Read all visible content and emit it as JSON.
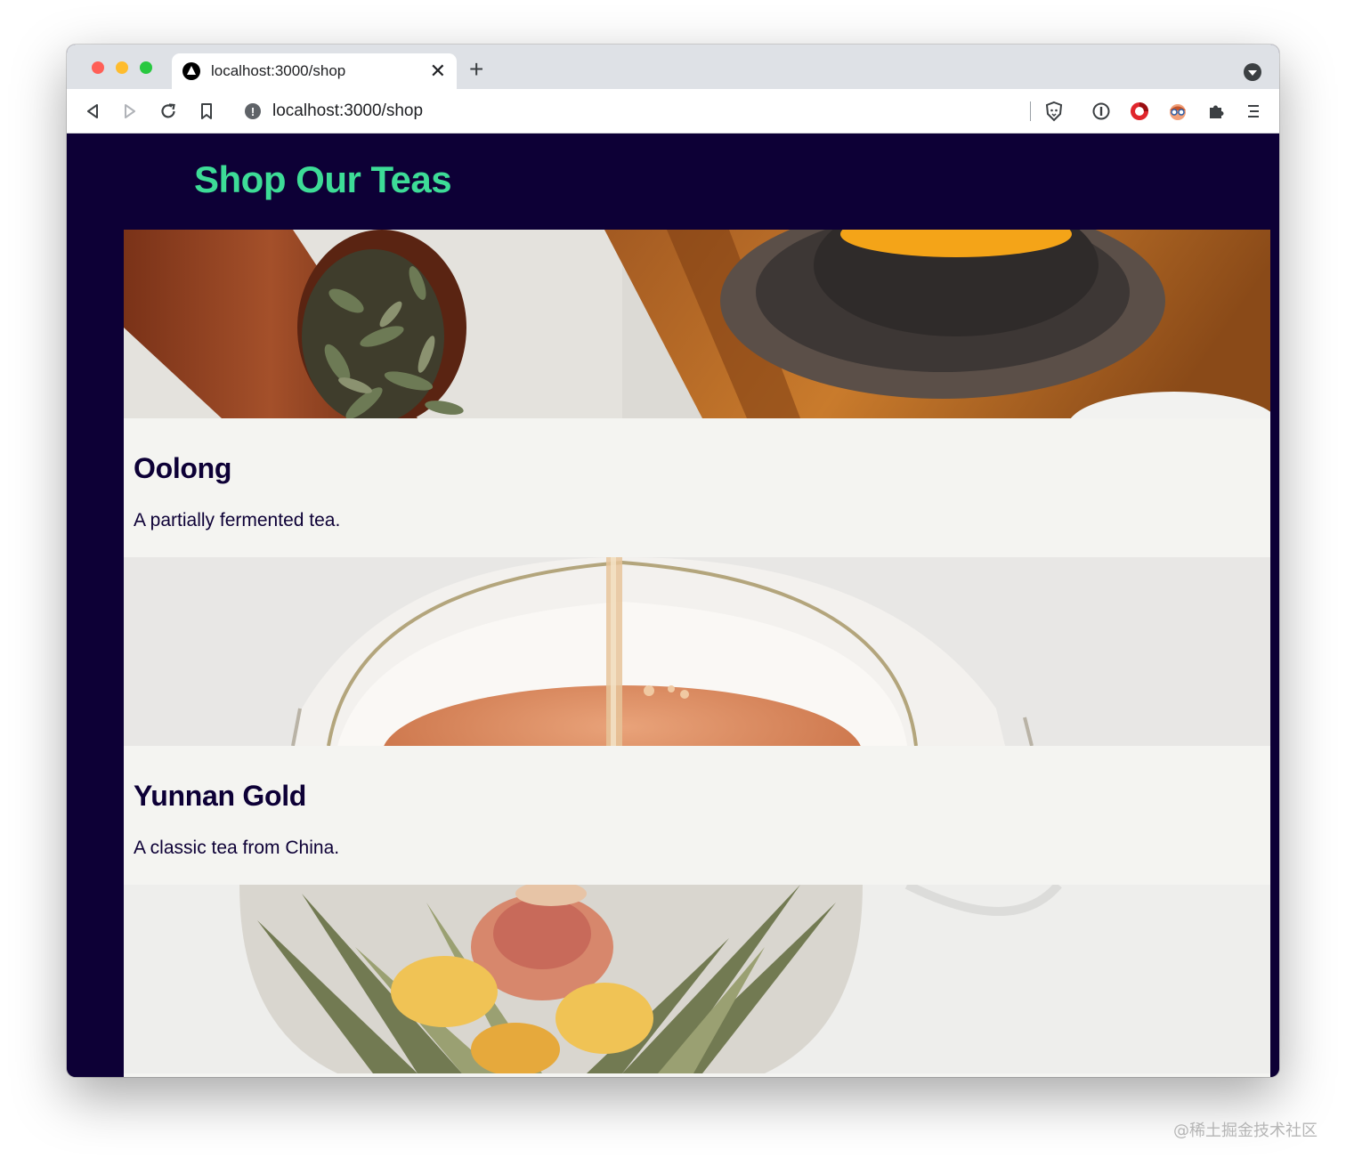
{
  "browser": {
    "tab_title": "localhost:3000/shop",
    "url": "localhost:3000/shop",
    "new_tab_label": "+",
    "close_tab_label": "✕"
  },
  "page": {
    "title": "Shop Our Teas",
    "teas": [
      {
        "name": "Oolong",
        "description": "A partially fermented tea."
      },
      {
        "name": "Yunnan Gold",
        "description": "A classic tea from China."
      },
      {
        "name": "",
        "description": ""
      }
    ]
  },
  "watermark": "@稀土掘金技术社区",
  "colors": {
    "page_background": "#0d0036",
    "title": "#3ddc97",
    "card_background": "#f4f4f1",
    "card_text": "#0d0036"
  }
}
